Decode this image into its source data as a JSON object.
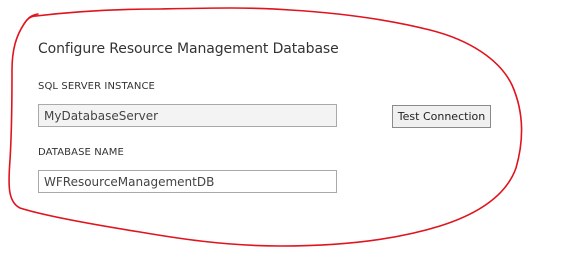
{
  "form": {
    "title": "Configure Resource Management Database",
    "sql_server_label": "SQL SERVER INSTANCE",
    "sql_server_value": "MyDatabaseServer",
    "test_connection_label": "Test Connection",
    "database_name_label": "DATABASE NAME",
    "database_name_value": "WFResourceManagementDB"
  },
  "annotation": {
    "color": "#e0141e"
  }
}
